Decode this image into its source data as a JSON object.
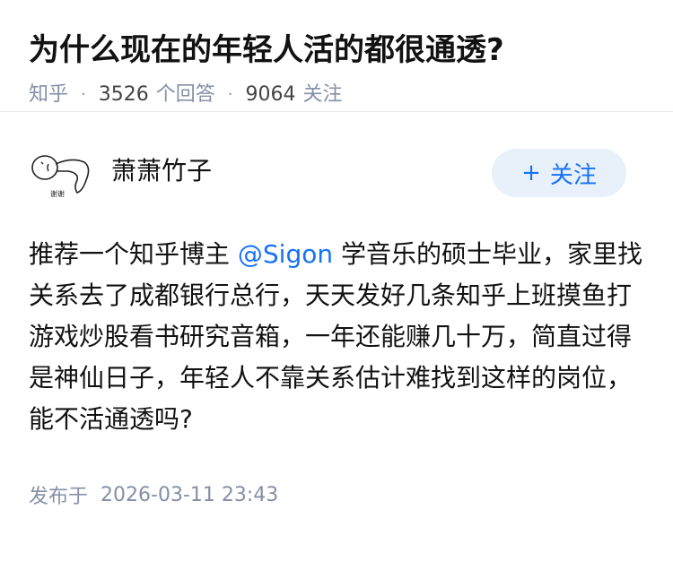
{
  "question": {
    "title": "为什么现在的年轻人活的都很通透?",
    "source": "知乎",
    "answer_count": "3526",
    "answer_label": "个回答",
    "follower_count": "9064",
    "follower_label": "关注",
    "separator": "·"
  },
  "answer": {
    "author": {
      "name": "萧萧竹子",
      "avatar_caption": "谢谢"
    },
    "follow_button": {
      "plus": "+",
      "label": "关注"
    },
    "content": {
      "before_mention": "推荐一个知乎博主 ",
      "mention": "@Sigon",
      "after_mention": " 学音乐的硕士毕业，家里找关系去了成都银行总行，天天发好几条知乎上班摸鱼打游戏炒股看书研究音箱，一年还能赚几十万，简直过得是神仙日子，年轻人不靠关系估计难找到这样的岗位，能不活通透吗?"
    },
    "publish": {
      "label": "发布于",
      "time": "2026-03-11 23:43"
    }
  },
  "colors": {
    "accent": "#1772f6",
    "meta": "#8590a6",
    "follow_bg": "#e8f0fa"
  }
}
